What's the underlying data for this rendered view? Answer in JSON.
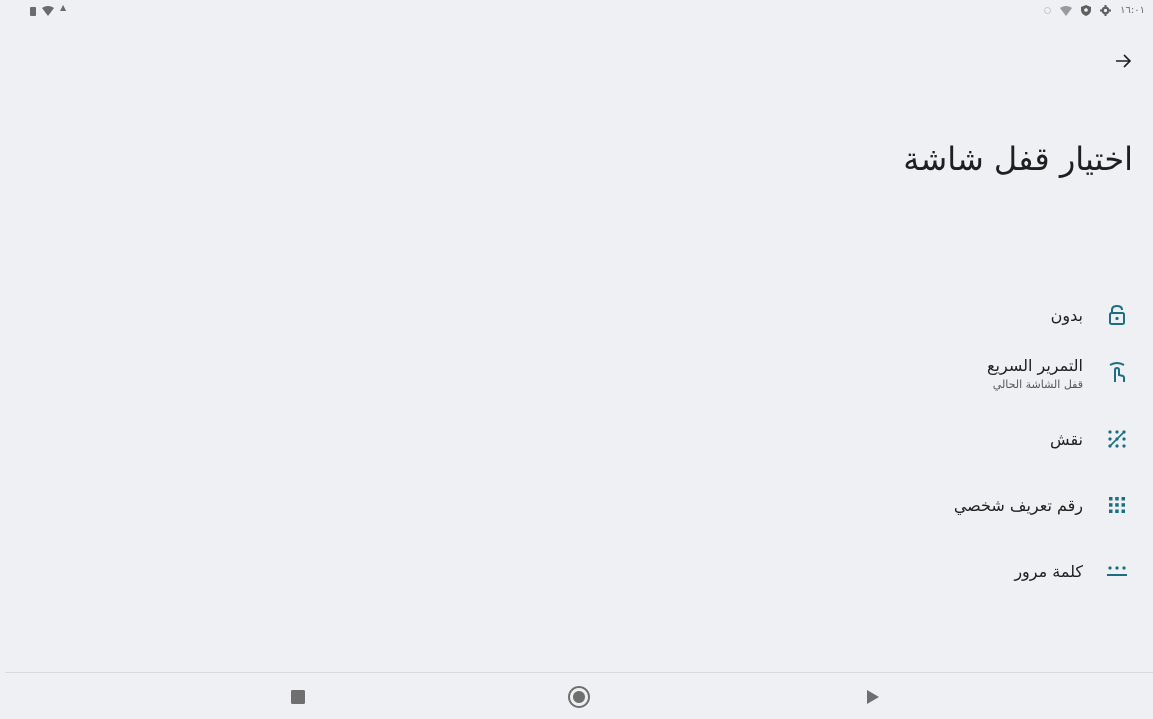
{
  "status_bar": {
    "left_icons": [
      "battery-icon",
      "wifi-alert-icon",
      "notification-icon"
    ],
    "right_icons": [
      "data-saver-icon",
      "wifi-icon",
      "vpn-shield-icon",
      "settings-icon"
    ],
    "time": "١٦:٠١"
  },
  "header": {
    "back_icon": "arrow-back-icon",
    "title": "اختيار قفل شاشة"
  },
  "options": [
    {
      "id": "none",
      "icon": "unlock-icon",
      "label": "بدون",
      "sublabel": ""
    },
    {
      "id": "swipe",
      "icon": "swipe-icon",
      "label": "التمرير السريع",
      "sublabel": "قفل الشاشة الحالي"
    },
    {
      "id": "pattern",
      "icon": "pattern-icon",
      "label": "نقش",
      "sublabel": ""
    },
    {
      "id": "pin",
      "icon": "pin-icon",
      "label": "رقم تعريف شخصي",
      "sublabel": ""
    },
    {
      "id": "password",
      "icon": "password-icon",
      "label": "كلمة مرور",
      "sublabel": ""
    }
  ],
  "nav_bar": {
    "buttons": [
      "recents-icon",
      "home-icon",
      "back-icon"
    ]
  },
  "colors": {
    "background": "#eef0f3",
    "accent": "#1b6f80",
    "text": "#1f1f1f"
  }
}
